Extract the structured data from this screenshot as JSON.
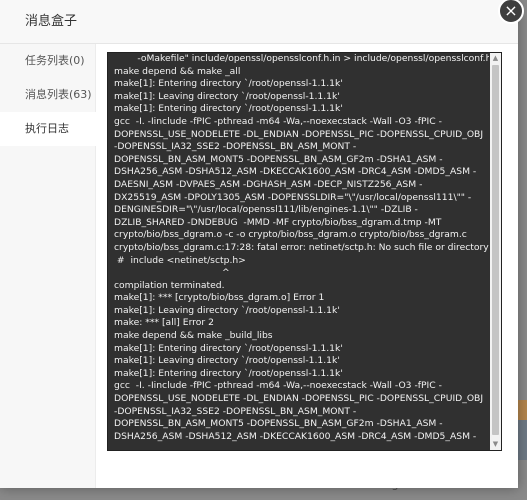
{
  "modal": {
    "title": "消息盒子",
    "close_symbol": "×"
  },
  "sidebar": {
    "items": [
      {
        "label": "任务列表(0)",
        "active": false
      },
      {
        "label": "消息列表(63)",
        "active": false
      },
      {
        "label": "执行日志",
        "active": true
      }
    ]
  },
  "log": {
    "lines": [
      "        -oMakefile\" include/openssl/opensslconf.h.in > include/openssl/opensslconf.h",
      "make depend && make _all",
      "make[1]: Entering directory `/root/openssl-1.1.1k'",
      "make[1]: Leaving directory `/root/openssl-1.1.1k'",
      "make[1]: Entering directory `/root/openssl-1.1.1k'",
      "gcc  -I. -Iinclude -fPIC -pthread -m64 -Wa,--noexecstack -Wall -O3 -fPIC -",
      "DOPENSSL_USE_NODELETE -DL_ENDIAN -DOPENSSL_PIC -DOPENSSL_CPUID_OBJ",
      "-DOPENSSL_IA32_SSE2 -DOPENSSL_BN_ASM_MONT -",
      "DOPENSSL_BN_ASM_MONT5 -DOPENSSL_BN_ASM_GF2m -DSHA1_ASM -",
      "DSHA256_ASM -DSHA512_ASM -DKECCAK1600_ASM -DRC4_ASM -DMD5_ASM -",
      "DAESNI_ASM -DVPAES_ASM -DGHASH_ASM -DECP_NISTZ256_ASM -",
      "DX25519_ASM -DPOLY1305_ASM -DOPENSSLDIR=\"\\\"/usr/local/openssl111\\\"\" -",
      "DENGINESDIR=\"\\\"/usr/local/openssl111/lib/engines-1.1\\\"\" -DZLIB -",
      "DZLIB_SHARED -DNDEBUG  -MMD -MF crypto/bio/bss_dgram.d.tmp -MT",
      "crypto/bio/bss_dgram.o -c -o crypto/bio/bss_dgram.o crypto/bio/bss_dgram.c",
      "crypto/bio/bss_dgram.c:17:28: fatal error: netinet/sctp.h: No such file or directory",
      " #  include <netinet/sctp.h>",
      "                                     ^",
      "compilation terminated.",
      "make[1]: *** [crypto/bio/bss_dgram.o] Error 1",
      "make[1]: Leaving directory `/root/openssl-1.1.1k'",
      "make: *** [all] Error 2",
      "make depend && make _build_libs",
      "make[1]: Entering directory `/root/openssl-1.1.1k'",
      "make[1]: Leaving directory `/root/openssl-1.1.1k'",
      "make[1]: Entering directory `/root/openssl-1.1.1k'",
      "gcc  -I. -Iinclude -fPIC -pthread -m64 -Wa,--noexecstack -Wall -O3 -fPIC -",
      "DOPENSSL_USE_NODELETE -DL_ENDIAN -DOPENSSL_PIC -DOPENSSL_CPUID_OBJ",
      "-DOPENSSL_IA32_SSE2 -DOPENSSL_BN_ASM_MONT -",
      "DOPENSSL_BN_ASM_MONT5 -DOPENSSL_BN_ASM_GF2m -DSHA1_ASM -",
      "DSHA256_ASM -DSHA512_ASM -DKECCAK1600_ASM -DRC4_ASM -DMD5_ASM -"
    ]
  },
  "background": {
    "number": "5"
  },
  "colors": {
    "terminal_bg": "#303030",
    "terminal_text": "#f2f2f2",
    "header_bg": "#f8f8f8",
    "sidebar_bg": "#f7f7f7",
    "close_bg": "#3e3e3e"
  }
}
